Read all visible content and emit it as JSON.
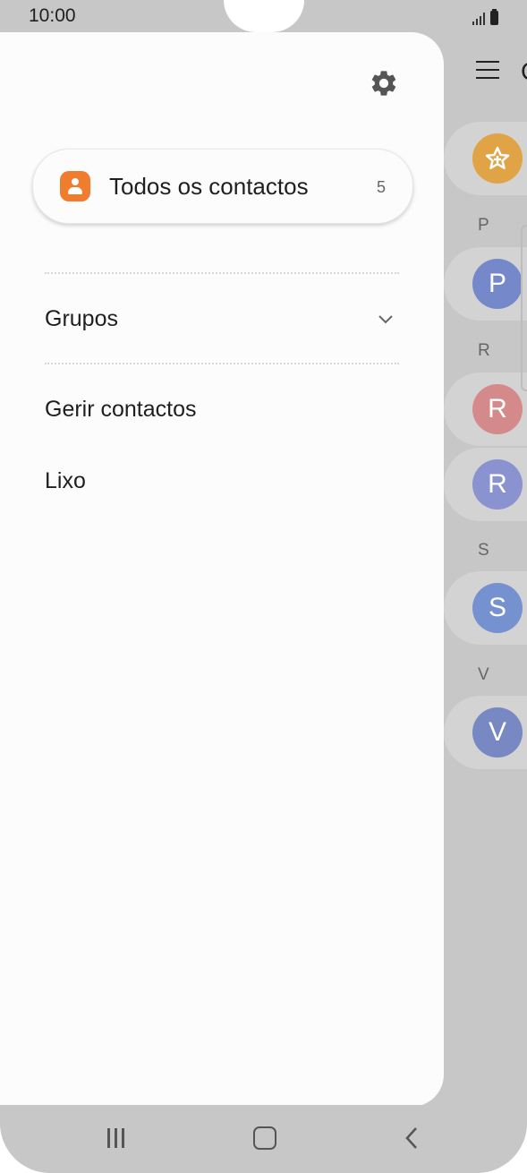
{
  "status_bar": {
    "time": "10:00"
  },
  "drawer": {
    "all_contacts": {
      "label": "Todos os contactos",
      "count": "5"
    },
    "groups_label": "Grupos",
    "manage_label": "Gerir contactos",
    "trash_label": "Lixo"
  },
  "background_list": {
    "title_partial": "C",
    "sections": [
      {
        "letter": "P",
        "avatar": "P",
        "color": "#7588c9"
      },
      {
        "letter": "R",
        "avatars": [
          {
            "avatar": "R",
            "color": "#d48a8a"
          },
          {
            "avatar": "R",
            "color": "#8a92cf"
          }
        ]
      },
      {
        "letter": "S",
        "avatar": "S",
        "color": "#7591cf"
      },
      {
        "letter": "V",
        "avatar": "V",
        "color": "#7888c2"
      }
    ],
    "favorites_color": "#e0a446"
  },
  "icons": {
    "settings": "gear-icon",
    "all_contacts": "person-icon",
    "groups_expand": "chevron-down-icon",
    "menu": "hamburger-icon",
    "nav_recent": "recent-apps-icon",
    "nav_home": "home-icon",
    "nav_back": "back-icon"
  },
  "colors": {
    "accent": "#f07c2e",
    "drawer_bg": "#fcfcfc",
    "scrim": "#c7c7c7"
  }
}
